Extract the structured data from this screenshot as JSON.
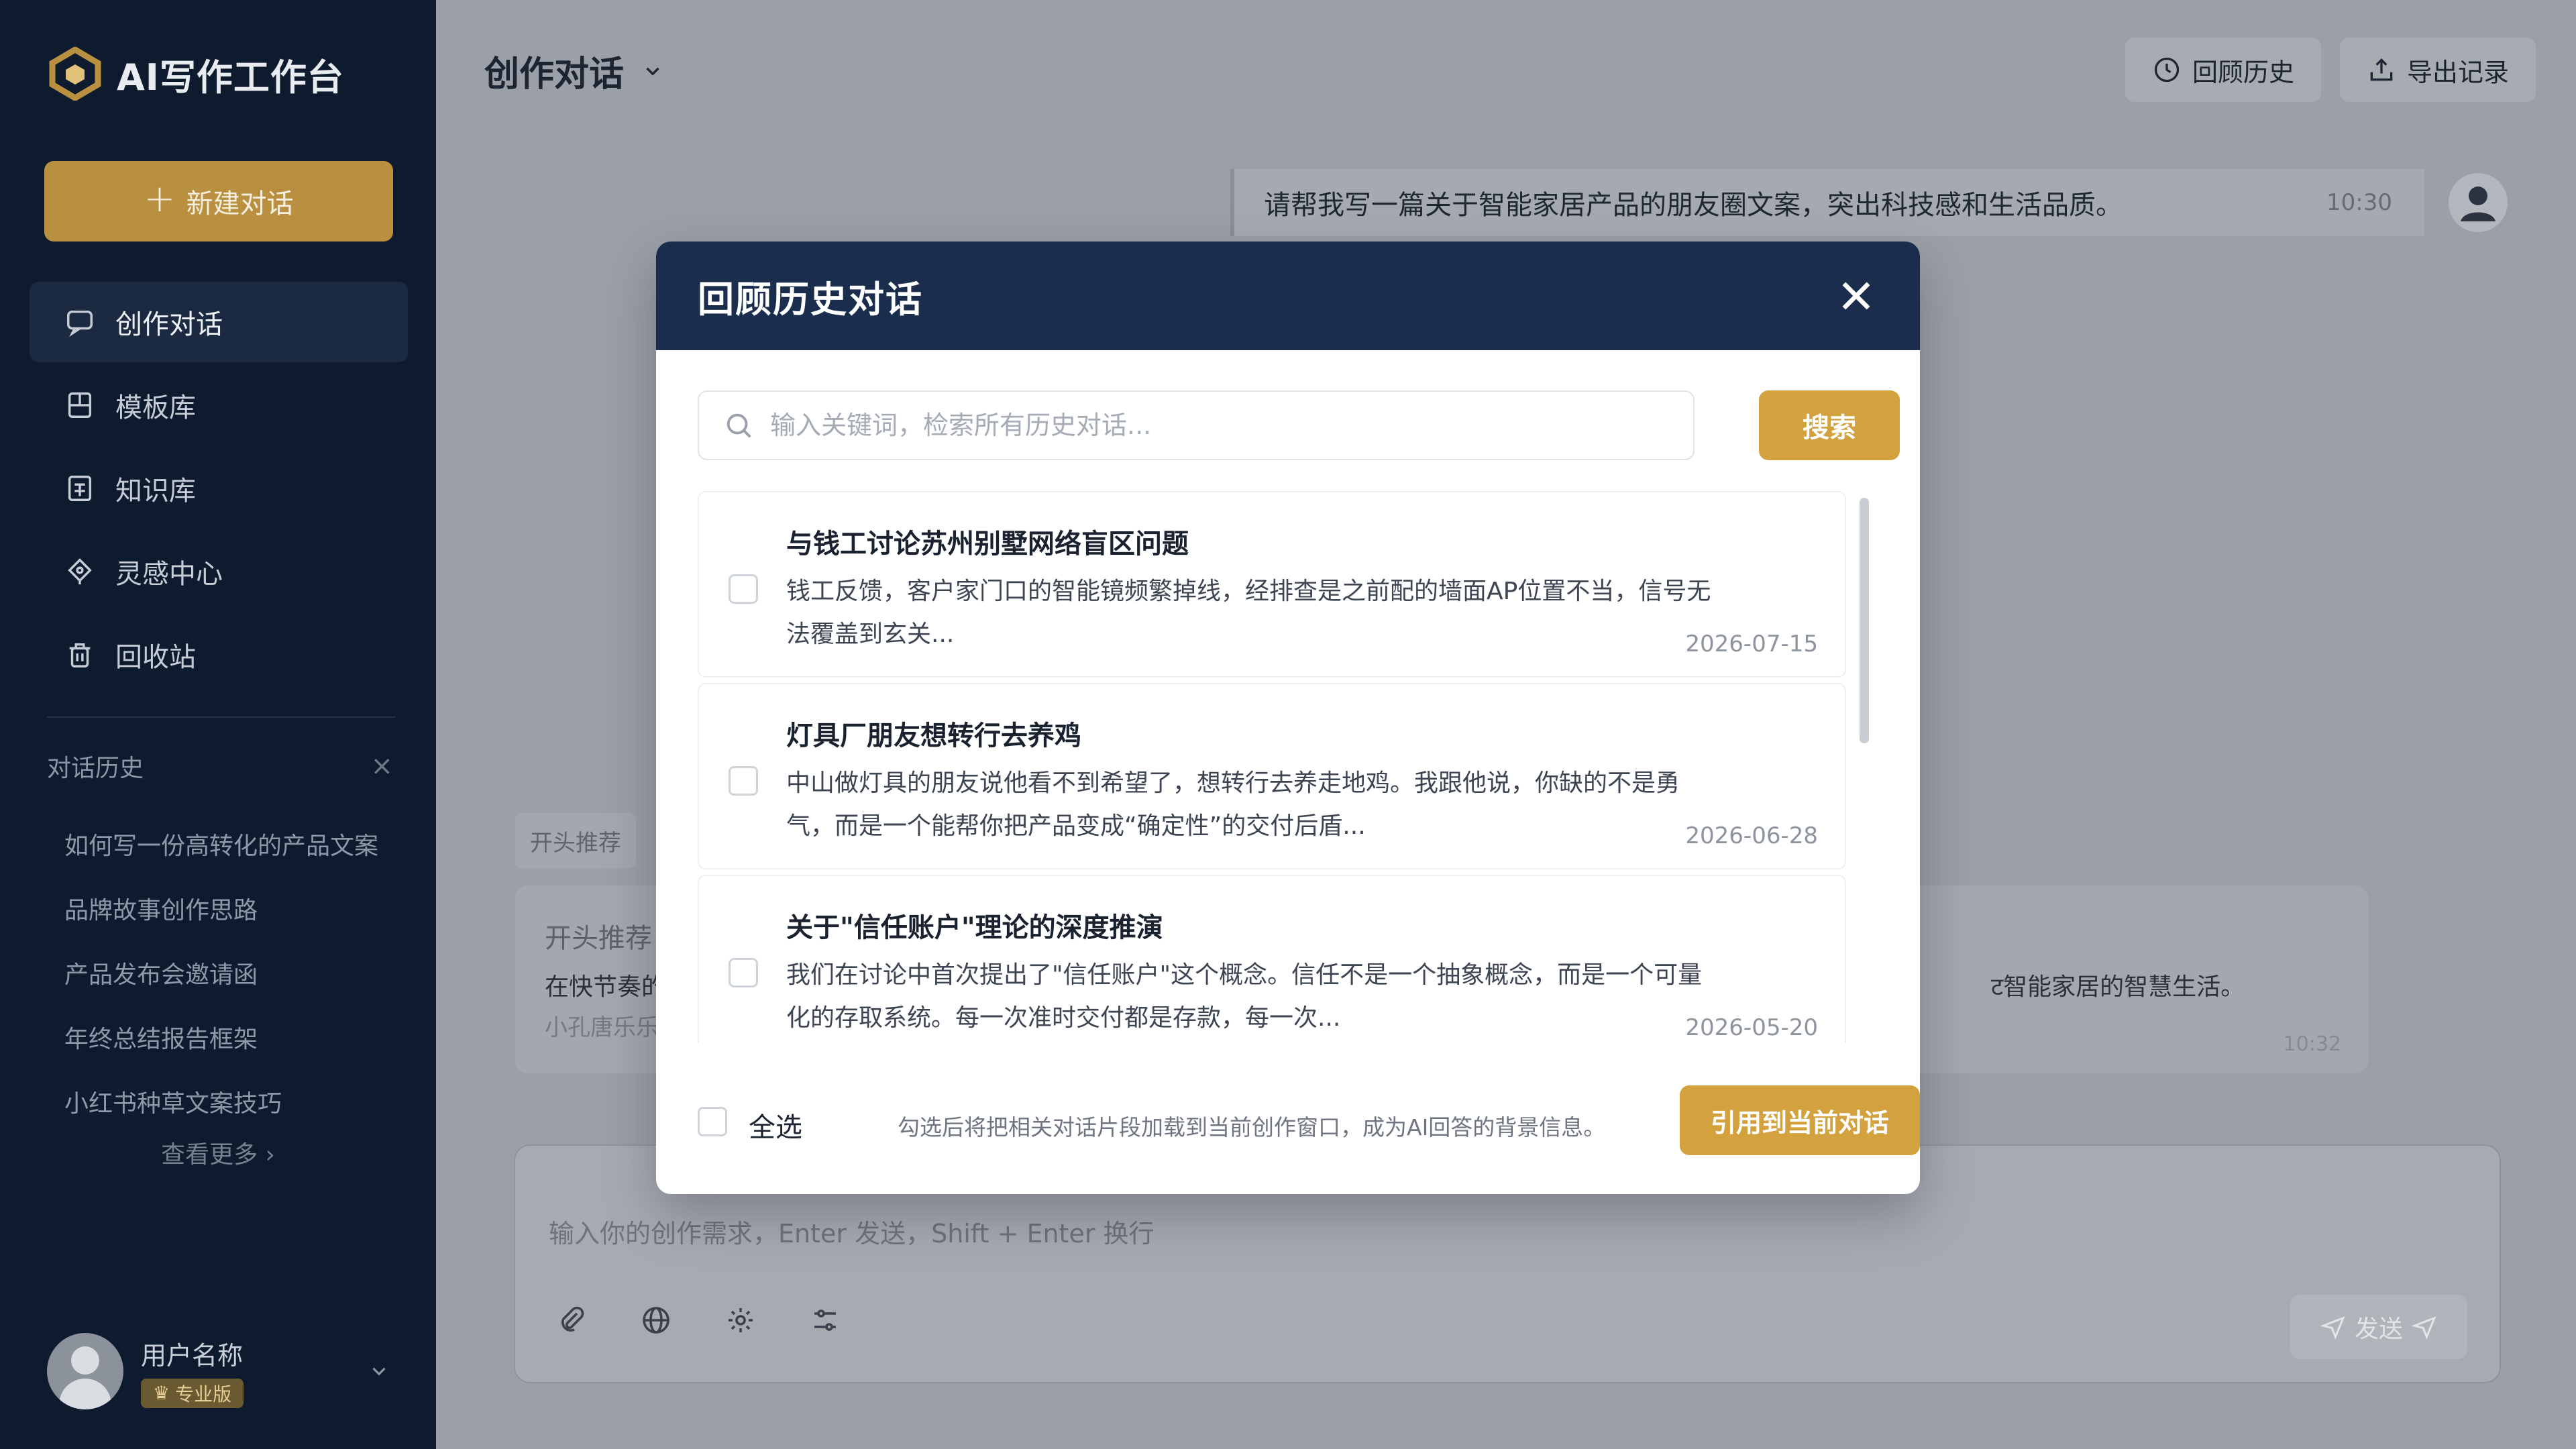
{
  "colors": {
    "sidebar_bg": "#0e1b2e",
    "accent_gold": "#d3a23f",
    "modal_header_bg": "#1b2d4c",
    "overlay_bg": "#9ba0a8"
  },
  "app": {
    "name": "AI写作工作台"
  },
  "sidebar": {
    "new_chat_label": "新建对话",
    "nav": [
      {
        "label": "创作对话",
        "icon": "chat-icon",
        "active": true
      },
      {
        "label": "模板库",
        "icon": "template-icon"
      },
      {
        "label": "知识库",
        "icon": "knowledge-icon"
      },
      {
        "label": "灵感中心",
        "icon": "lightbulb-icon"
      },
      {
        "label": "回收站",
        "icon": "trash-icon"
      }
    ],
    "history_title": "对话历史",
    "history_items": [
      "如何写一份高转化的产品文案",
      "品牌故事创作思路",
      "产品发布会邀请函",
      "年终总结报告框架",
      "小红书种草文案技巧"
    ],
    "see_more": "查看更多 ›",
    "user": {
      "name": "用户名称",
      "plan": "专业版"
    }
  },
  "topbar": {
    "title": "创作对话",
    "history_btn": "回顾历史",
    "export_btn": "导出记录"
  },
  "chat": {
    "user_message": "请帮我写一篇关于智能家居产品的朋友圈文案，突出科技感和生活品质。",
    "user_time": "10:30",
    "ai_tag": "开头推荐",
    "ai_heading": "开头推荐",
    "ai_line1": "在快节奏的",
    "ai_line2": "小孔唐乐乐",
    "ai_tail": "ट智能家居的智慧生活。",
    "ai_time": "10:32",
    "input_placeholder": "输入你的创作需求，Enter 发送，Shift + Enter 换行",
    "send_label": "发送"
  },
  "modal": {
    "title": "回顾历史对话",
    "search_placeholder": "输入关键词，检索所有历史对话...",
    "search_btn": "搜索",
    "items": [
      {
        "title": "与钱工讨论苏州别墅网络盲区问题",
        "desc": "钱工反馈，客户家门口的智能镜频繁掉线，经排查是之前配的墙面AP位置不当，信号无法覆盖到玄关...",
        "date": "2026-07-15"
      },
      {
        "title": "灯具厂朋友想转行去养鸡",
        "desc": "中山做灯具的朋友说他看不到希望了，想转行去养走地鸡。我跟他说，你缺的不是勇气，而是一个能帮你把产品变成“确定性”的交付后盾...",
        "date": "2026-06-28"
      },
      {
        "title": "关于\"信任账户\"理论的深度推演",
        "desc": "我们在讨论中首次提出了\"信任账户\"这个概念。信任不是一个抽象概念，而是一个可量化的存取系统。每一次准时交付都是存款，每一次...",
        "date": "2026-05-20"
      }
    ],
    "select_all": "全选",
    "hint": "勾选后将把相关对话片段加载到当前创作窗口，成为AI回答的背景信息。",
    "cite_btn": "引用到当前对话"
  }
}
